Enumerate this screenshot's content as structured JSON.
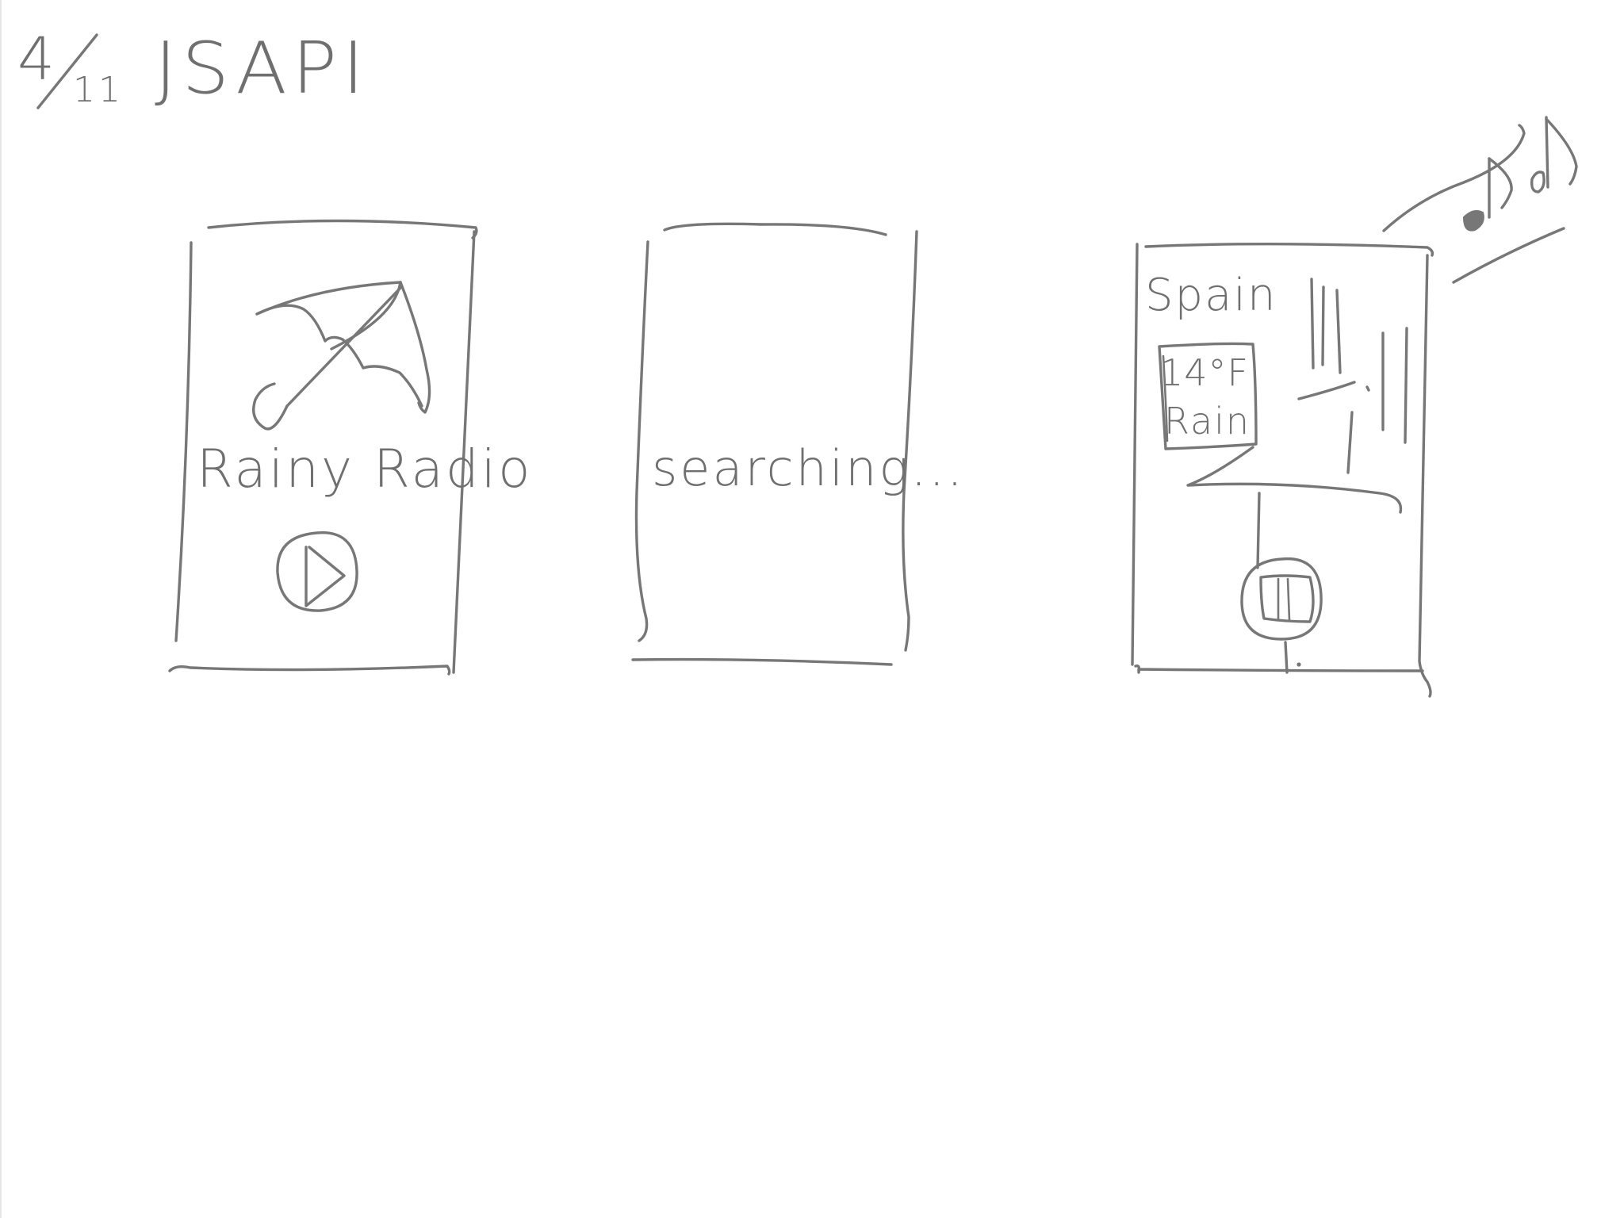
{
  "header": {
    "date_numerator": "4",
    "date_denominator": "11",
    "title": "JSAPI"
  },
  "screens": {
    "home": {
      "app_title": "Rainy Radio",
      "icon": "umbrella-icon",
      "action_icon": "play-icon"
    },
    "loading": {
      "status_text": "searching..."
    },
    "player": {
      "location": "Spain",
      "temperature": "14°F",
      "condition": "Rain",
      "action_icon": "pause-icon",
      "decoration_icon": "music-notes-icon"
    }
  }
}
